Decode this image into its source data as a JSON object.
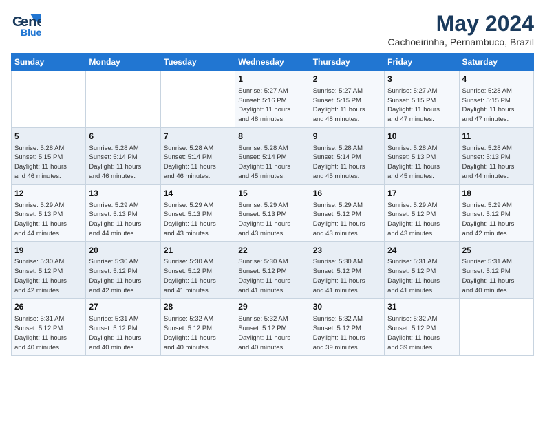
{
  "header": {
    "logo_text_general": "General",
    "logo_text_blue": "Blue",
    "month_year": "May 2024",
    "location": "Cachoeirinha, Pernambuco, Brazil"
  },
  "days_of_week": [
    "Sunday",
    "Monday",
    "Tuesday",
    "Wednesday",
    "Thursday",
    "Friday",
    "Saturday"
  ],
  "weeks": [
    [
      {
        "day": "",
        "info": ""
      },
      {
        "day": "",
        "info": ""
      },
      {
        "day": "",
        "info": ""
      },
      {
        "day": "1",
        "info": "Sunrise: 5:27 AM\nSunset: 5:16 PM\nDaylight: 11 hours\nand 48 minutes."
      },
      {
        "day": "2",
        "info": "Sunrise: 5:27 AM\nSunset: 5:15 PM\nDaylight: 11 hours\nand 48 minutes."
      },
      {
        "day": "3",
        "info": "Sunrise: 5:27 AM\nSunset: 5:15 PM\nDaylight: 11 hours\nand 47 minutes."
      },
      {
        "day": "4",
        "info": "Sunrise: 5:28 AM\nSunset: 5:15 PM\nDaylight: 11 hours\nand 47 minutes."
      }
    ],
    [
      {
        "day": "5",
        "info": "Sunrise: 5:28 AM\nSunset: 5:15 PM\nDaylight: 11 hours\nand 46 minutes."
      },
      {
        "day": "6",
        "info": "Sunrise: 5:28 AM\nSunset: 5:14 PM\nDaylight: 11 hours\nand 46 minutes."
      },
      {
        "day": "7",
        "info": "Sunrise: 5:28 AM\nSunset: 5:14 PM\nDaylight: 11 hours\nand 46 minutes."
      },
      {
        "day": "8",
        "info": "Sunrise: 5:28 AM\nSunset: 5:14 PM\nDaylight: 11 hours\nand 45 minutes."
      },
      {
        "day": "9",
        "info": "Sunrise: 5:28 AM\nSunset: 5:14 PM\nDaylight: 11 hours\nand 45 minutes."
      },
      {
        "day": "10",
        "info": "Sunrise: 5:28 AM\nSunset: 5:13 PM\nDaylight: 11 hours\nand 45 minutes."
      },
      {
        "day": "11",
        "info": "Sunrise: 5:28 AM\nSunset: 5:13 PM\nDaylight: 11 hours\nand 44 minutes."
      }
    ],
    [
      {
        "day": "12",
        "info": "Sunrise: 5:29 AM\nSunset: 5:13 PM\nDaylight: 11 hours\nand 44 minutes."
      },
      {
        "day": "13",
        "info": "Sunrise: 5:29 AM\nSunset: 5:13 PM\nDaylight: 11 hours\nand 44 minutes."
      },
      {
        "day": "14",
        "info": "Sunrise: 5:29 AM\nSunset: 5:13 PM\nDaylight: 11 hours\nand 43 minutes."
      },
      {
        "day": "15",
        "info": "Sunrise: 5:29 AM\nSunset: 5:13 PM\nDaylight: 11 hours\nand 43 minutes."
      },
      {
        "day": "16",
        "info": "Sunrise: 5:29 AM\nSunset: 5:12 PM\nDaylight: 11 hours\nand 43 minutes."
      },
      {
        "day": "17",
        "info": "Sunrise: 5:29 AM\nSunset: 5:12 PM\nDaylight: 11 hours\nand 43 minutes."
      },
      {
        "day": "18",
        "info": "Sunrise: 5:29 AM\nSunset: 5:12 PM\nDaylight: 11 hours\nand 42 minutes."
      }
    ],
    [
      {
        "day": "19",
        "info": "Sunrise: 5:30 AM\nSunset: 5:12 PM\nDaylight: 11 hours\nand 42 minutes."
      },
      {
        "day": "20",
        "info": "Sunrise: 5:30 AM\nSunset: 5:12 PM\nDaylight: 11 hours\nand 42 minutes."
      },
      {
        "day": "21",
        "info": "Sunrise: 5:30 AM\nSunset: 5:12 PM\nDaylight: 11 hours\nand 41 minutes."
      },
      {
        "day": "22",
        "info": "Sunrise: 5:30 AM\nSunset: 5:12 PM\nDaylight: 11 hours\nand 41 minutes."
      },
      {
        "day": "23",
        "info": "Sunrise: 5:30 AM\nSunset: 5:12 PM\nDaylight: 11 hours\nand 41 minutes."
      },
      {
        "day": "24",
        "info": "Sunrise: 5:31 AM\nSunset: 5:12 PM\nDaylight: 11 hours\nand 41 minutes."
      },
      {
        "day": "25",
        "info": "Sunrise: 5:31 AM\nSunset: 5:12 PM\nDaylight: 11 hours\nand 40 minutes."
      }
    ],
    [
      {
        "day": "26",
        "info": "Sunrise: 5:31 AM\nSunset: 5:12 PM\nDaylight: 11 hours\nand 40 minutes."
      },
      {
        "day": "27",
        "info": "Sunrise: 5:31 AM\nSunset: 5:12 PM\nDaylight: 11 hours\nand 40 minutes."
      },
      {
        "day": "28",
        "info": "Sunrise: 5:32 AM\nSunset: 5:12 PM\nDaylight: 11 hours\nand 40 minutes."
      },
      {
        "day": "29",
        "info": "Sunrise: 5:32 AM\nSunset: 5:12 PM\nDaylight: 11 hours\nand 40 minutes."
      },
      {
        "day": "30",
        "info": "Sunrise: 5:32 AM\nSunset: 5:12 PM\nDaylight: 11 hours\nand 39 minutes."
      },
      {
        "day": "31",
        "info": "Sunrise: 5:32 AM\nSunset: 5:12 PM\nDaylight: 11 hours\nand 39 minutes."
      },
      {
        "day": "",
        "info": ""
      }
    ]
  ]
}
